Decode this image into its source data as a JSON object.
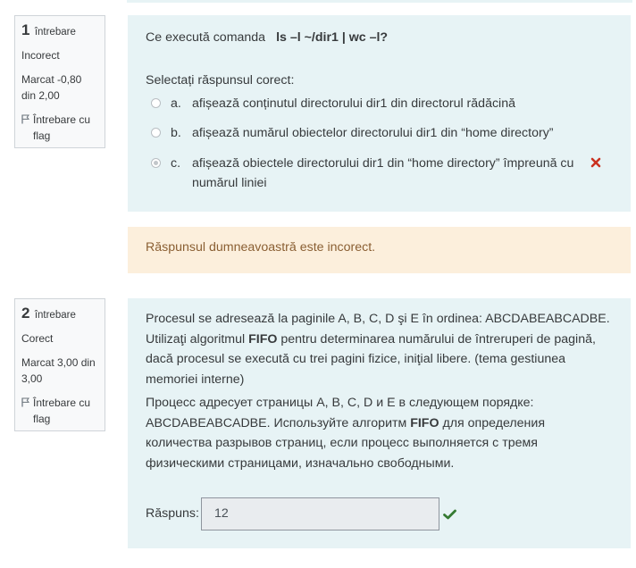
{
  "q1": {
    "number": "1",
    "word": "întrebare",
    "state": "Incorect",
    "grade": "Marcat -0,80 din 2,00",
    "flag_label": "Întrebare cu flag",
    "question_prefix": "Ce execută comanda",
    "command": "ls –l ~/dir1 | wc –l?",
    "prompt": "Selectați răspunsul corect:",
    "options": [
      {
        "letter": "a.",
        "text": "afișează conținutul directorului dir1  din directorul rădăcină",
        "selected": false
      },
      {
        "letter": "b.",
        "text": "afișează numărul obiectelor directorului dir1  din “home directory”",
        "selected": false
      },
      {
        "letter": "c.",
        "text": "afișează obiectele directorului dir1  din “home directory” împreună cu numărul liniei",
        "selected": true,
        "mark": "incorrect"
      }
    ],
    "feedback": "Răspunsul dumneavoastră este incorect."
  },
  "q2": {
    "number": "2",
    "word": "întrebare",
    "state": "Corect",
    "grade": "Marcat 3,00 din 3,00",
    "flag_label": "Întrebare cu flag",
    "ro_before": "Procesul se adresează la paginile A, B, C, D şi E în ordinea:  ABCDABEABCADBE. Utilizaţi algoritmul",
    "ro_bold": "FIFO",
    "ro_after": "pentru determinarea numărului de întreruperi de pagină, dacă procesul se execută cu trei pagini fizice, iniţial libere.   (tema gestiunea memoriei interne)",
    "ru_before": "Процесс адресует страницы A, B, C, D и E в следующем порядке: ABCDABEABCADBE. Используйте алгоритм",
    "ru_bold": "FIFO",
    "ru_after": "для определения количества разрывов страниц, если процесс выполняется с тремя физическими страницами, изначально свободными.",
    "answer_label": "Răspuns:",
    "answer_value": "12"
  },
  "colors": {
    "content_bg": "#e7f3f5",
    "info_bg": "#f8f9fa",
    "feedback_bg": "#fcefdc",
    "feedback_text": "#8a5f33",
    "incorrect": "#ca3120",
    "correct": "#357a32"
  },
  "icons": {
    "flag": "flag-icon",
    "incorrect": "x-mark-icon",
    "correct": "check-mark-icon"
  }
}
